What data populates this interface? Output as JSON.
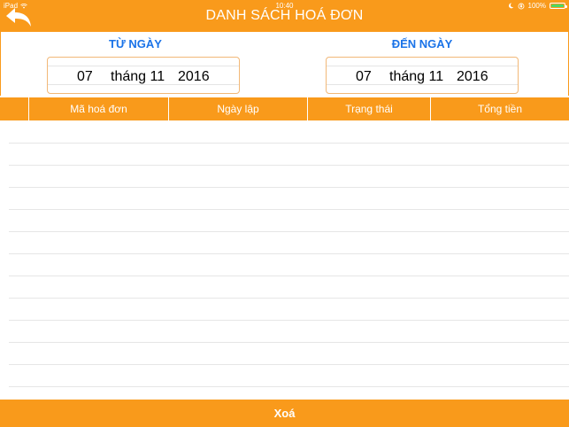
{
  "status_bar": {
    "device": "iPad",
    "time": "10:40",
    "battery": "100%",
    "battery_level": 1.0
  },
  "nav": {
    "title": "DANH SÁCH HOÁ ĐƠN",
    "back_icon": "back-arrow-icon"
  },
  "filter": {
    "from_label": "TỪ NGÀY",
    "to_label": "ĐẾN NGÀY",
    "from_date": {
      "day": "07",
      "month": "tháng 11",
      "year": "2016"
    },
    "to_date": {
      "day": "07",
      "month": "tháng 11",
      "year": "2016"
    }
  },
  "table": {
    "columns": [
      "",
      "Mã hoá đơn",
      "Ngày lập",
      "Trạng thái",
      "Tổng tiền"
    ],
    "rows": []
  },
  "actions": {
    "delete_label": "Xoá"
  },
  "colors": {
    "accent": "#f99a1b",
    "label_blue": "#1a73e8",
    "picker_text": "#3a3dbf"
  }
}
